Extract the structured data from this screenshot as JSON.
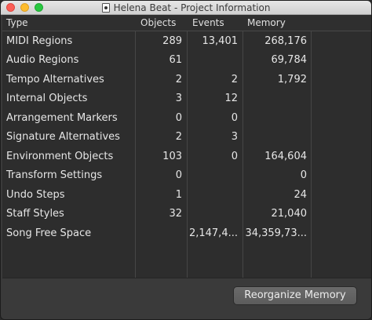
{
  "window": {
    "title": "Helena Beat - Project Information"
  },
  "table": {
    "columns": [
      "Type",
      "Objects",
      "Events",
      "Memory"
    ],
    "rows": [
      {
        "type": "MIDI Regions",
        "objects": "289",
        "events": "13,401",
        "memory": "268,176"
      },
      {
        "type": "Audio Regions",
        "objects": "61",
        "events": "",
        "memory": "69,784"
      },
      {
        "type": "Tempo Alternatives",
        "objects": "2",
        "events": "2",
        "memory": "1,792"
      },
      {
        "type": "Internal Objects",
        "objects": "3",
        "events": "12",
        "memory": ""
      },
      {
        "type": "Arrangement Markers",
        "objects": "0",
        "events": "0",
        "memory": ""
      },
      {
        "type": "Signature Alternatives",
        "objects": "2",
        "events": "3",
        "memory": ""
      },
      {
        "type": "Environment Objects",
        "objects": "103",
        "events": "0",
        "memory": "164,604"
      },
      {
        "type": "Transform Settings",
        "objects": "0",
        "events": "",
        "memory": "0"
      },
      {
        "type": "Undo Steps",
        "objects": "1",
        "events": "",
        "memory": "24"
      },
      {
        "type": "Staff Styles",
        "objects": "32",
        "events": "",
        "memory": "21,040"
      },
      {
        "type": "Song Free Space",
        "objects": "",
        "events": "2,147,4...",
        "memory": "34,359,73..."
      }
    ]
  },
  "footer": {
    "reorganize_label": "Reorganize Memory"
  }
}
